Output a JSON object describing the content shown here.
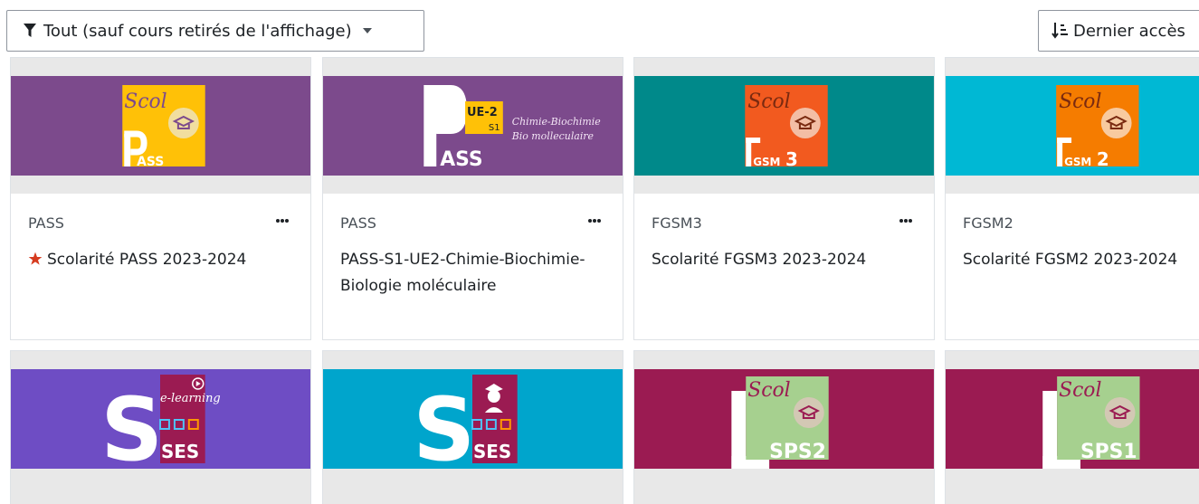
{
  "toolbar": {
    "filter_label": "Tout (sauf cours retirés de l'affichage)",
    "sort_label": "Dernier accès"
  },
  "courses": [
    {
      "category": "PASS",
      "title": "Scolarité PASS 2023-2024",
      "starred": true,
      "logo": "scol-pass"
    },
    {
      "category": "PASS",
      "title": "PASS-S1-UE2-Chimie-Biochimie-Biologie moléculaire",
      "starred": false,
      "logo": "pass-ue2"
    },
    {
      "category": "FGSM3",
      "title": "Scolarité FGSM3 2023-2024",
      "starred": false,
      "logo": "scol-fgsm3"
    },
    {
      "category": "FGSM2",
      "title": "Scolarité FGSM2 2023-2024",
      "starred": false,
      "logo": "scol-fgsm2"
    },
    {
      "logo": "ses-elearning"
    },
    {
      "logo": "ses-graduate"
    },
    {
      "logo": "scol-sps2"
    },
    {
      "logo": "scol-sps1"
    }
  ],
  "logo_text": {
    "scol": "Scol",
    "ue2": "UE-2",
    "s1": "S1",
    "chimie_line1": "Chimie-Biochimie",
    "chimie_line2": "Bio molleculaire",
    "pass_small": "ASS",
    "pass_big": "ASS",
    "gsm3": "GSM",
    "num3": "3",
    "num2": "2",
    "elearning": "e-learning",
    "ses": "SES",
    "sps2": "SPS2",
    "sps1": "SPS1"
  },
  "colors": {
    "purple": "#7c4a8c",
    "teal": "#00898a",
    "cyan": "#00b8d4",
    "violet": "#6e4dc4",
    "blue": "#00a5cc",
    "maroon": "#9b1b52",
    "orange": "#f25a1f",
    "yellow": "#ffc107",
    "green": "#a6d08f",
    "star": "#d63b1f"
  }
}
